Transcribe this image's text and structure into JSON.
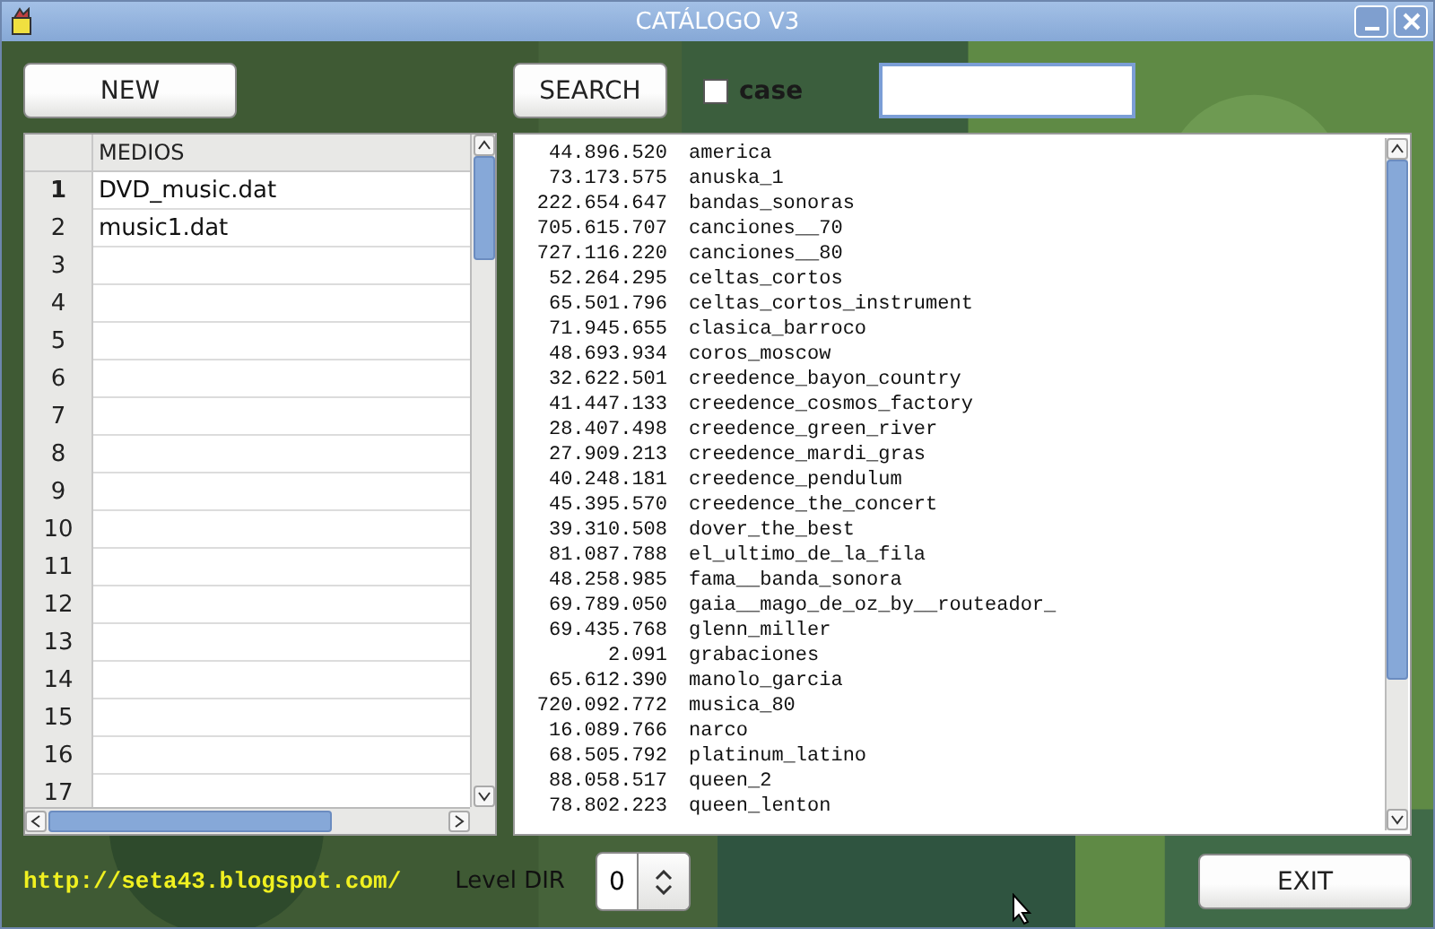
{
  "window": {
    "title": "CATÁLOGO V3"
  },
  "toolbar": {
    "new_button": "NEW",
    "search_button": "SEARCH",
    "case_checkbox": {
      "label": "case",
      "checked": false
    }
  },
  "media_table": {
    "column": "MEDIOS",
    "rows": [
      {
        "number": "1",
        "name": "DVD_music.dat",
        "selected": true
      },
      {
        "number": "2",
        "name": "music1.dat",
        "selected": false
      },
      {
        "number": "3",
        "selected": false
      },
      {
        "number": "4",
        "selected": false
      },
      {
        "number": "5",
        "selected": false
      },
      {
        "number": "6",
        "selected": false
      },
      {
        "number": "7",
        "selected": false
      },
      {
        "number": "8",
        "selected": false
      },
      {
        "number": "9",
        "selected": false
      },
      {
        "number": "10",
        "selected": false
      },
      {
        "number": "11",
        "selected": false
      },
      {
        "number": "12",
        "selected": false
      },
      {
        "number": "13",
        "selected": false
      },
      {
        "number": "14",
        "selected": false
      },
      {
        "number": "15",
        "selected": false
      },
      {
        "number": "16",
        "selected": false
      },
      {
        "number": "17",
        "selected": false
      }
    ]
  },
  "files": [
    {
      "size": "44.896.520",
      "name": "america"
    },
    {
      "size": "73.173.575",
      "name": "anuska_1"
    },
    {
      "size": "222.654.647",
      "name": "bandas_sonoras"
    },
    {
      "size": "705.615.707",
      "name": "canciones__70"
    },
    {
      "size": "727.116.220",
      "name": "canciones__80"
    },
    {
      "size": "52.264.295",
      "name": "celtas_cortos"
    },
    {
      "size": "65.501.796",
      "name": "celtas_cortos_instrument"
    },
    {
      "size": "71.945.655",
      "name": "clasica_barroco"
    },
    {
      "size": "48.693.934",
      "name": "coros_moscow"
    },
    {
      "size": "32.622.501",
      "name": "creedence_bayon_country"
    },
    {
      "size": "41.447.133",
      "name": "creedence_cosmos_factory"
    },
    {
      "size": "28.407.498",
      "name": "creedence_green_river"
    },
    {
      "size": "27.909.213",
      "name": "creedence_mardi_gras"
    },
    {
      "size": "40.248.181",
      "name": "creedence_pendulum"
    },
    {
      "size": "45.395.570",
      "name": "creedence_the_concert"
    },
    {
      "size": "39.310.508",
      "name": "dover_the_best"
    },
    {
      "size": "81.087.788",
      "name": "el_ultimo_de_la_fila"
    },
    {
      "size": "48.258.985",
      "name": "fama__banda_sonora"
    },
    {
      "size": "69.789.050",
      "name": "gaia__mago_de_oz_by__routeador_"
    },
    {
      "size": "69.435.768",
      "name": "glenn_miller"
    },
    {
      "size": "2.091",
      "name": "grabaciones"
    },
    {
      "size": "65.612.390",
      "name": "manolo_garcia"
    },
    {
      "size": "720.092.772",
      "name": "musica_80"
    },
    {
      "size": "16.089.766",
      "name": "narco"
    },
    {
      "size": "68.505.792",
      "name": "platinum_latino"
    },
    {
      "size": "88.058.517",
      "name": "queen_2"
    },
    {
      "size": "78.802.223",
      "name": "queen_lenton"
    }
  ],
  "footer": {
    "link": "http://seta43.blogspot.com/",
    "level_label": "Level DIR",
    "level_value": "0",
    "exit_button": "EXIT"
  }
}
